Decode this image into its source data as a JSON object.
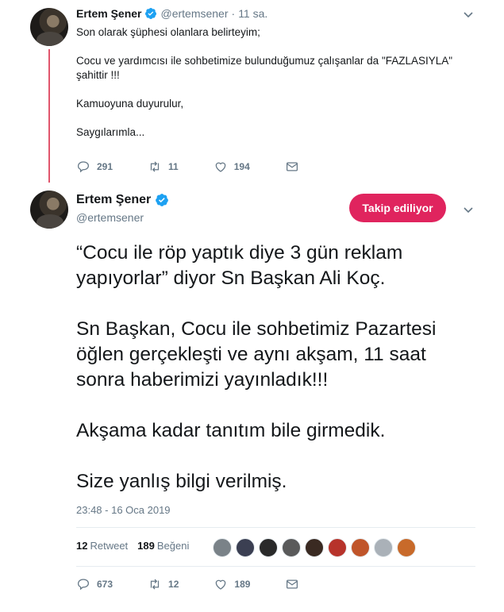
{
  "tweet1": {
    "name": "Ertem Şener",
    "handle": "@ertemsener",
    "time": "11 sa.",
    "lines": [
      "Son olarak şüphesi olanlara belirteyim;",
      "",
      "Cocu ve yardımcısı ile sohbetimize bulunduğumuz çalışanlar da \"FAZLASIYLA\"",
      "şahittir !!!",
      "",
      "Kamuoyuna duyurulur,",
      "",
      "Saygılarımla..."
    ],
    "replies": "291",
    "retweets": "11",
    "likes": "194"
  },
  "tweet2": {
    "name": "Ertem Şener",
    "handle": "@ertemsener",
    "follow_label": "Takip ediliyor",
    "lines": [
      "“Cocu ile röp yaptık diye 3 gün reklam",
      "yapıyorlar” diyor Sn Başkan Ali Koç.",
      "",
      "Sn Başkan, Cocu ile sohbetimiz Pazartesi",
      "öğlen gerçekleşti ve aynı akşam, 11 saat",
      "sonra haberimizi yayınladık!!!",
      "",
      "Akşama kadar tanıtım bile girmedik.",
      "",
      "Size yanlış bilgi verilmiş."
    ],
    "date": "23:48 - 16 Oca 2019",
    "retweet_count": "12",
    "retweet_label": "Retweet",
    "like_count": "189",
    "like_label": "Beğeni",
    "replies": "673",
    "retweets": "12",
    "likes": "189"
  },
  "colors": {
    "accent_red": "#e0245e",
    "thread_line": "#e1566d",
    "verified_blue": "#1da1f2",
    "secondary_text": "#657786"
  },
  "likers": [
    "#7a8288",
    "#3b3f52",
    "#2a2a2a",
    "#5a5a5a",
    "#3a2a22",
    "#b7332b",
    "#c0552a",
    "#aab1b8",
    "#c86a2a"
  ]
}
